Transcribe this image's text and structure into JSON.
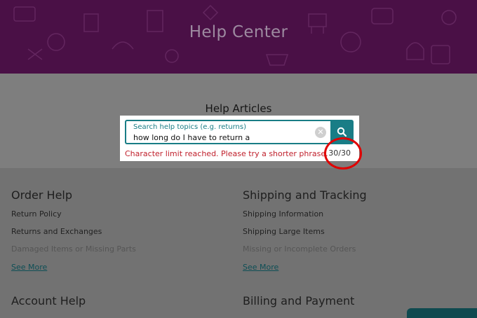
{
  "header": {
    "title": "Help Center",
    "background": "#4a1046"
  },
  "articles": {
    "heading": "Help Articles"
  },
  "search": {
    "placeholder": "Search help topics (e.g. returns)",
    "value": "how long do I have to return a",
    "clear_icon": "clear-icon",
    "search_icon": "magnifier-icon",
    "error": "Character limit reached. Please try a shorter phrase.",
    "count": "30/30",
    "accent": "#197d86",
    "error_color": "#c0202c"
  },
  "sections": {
    "order_help": {
      "title": "Order Help",
      "links": [
        "Return Policy",
        "Returns and Exchanges",
        "Damaged Items or Missing Parts"
      ],
      "see_more": "See More"
    },
    "shipping": {
      "title": "Shipping and Tracking",
      "links": [
        "Shipping Information",
        "Shipping Large Items",
        "Missing or Incomplete Orders"
      ],
      "see_more": "See More"
    },
    "account": {
      "title": "Account Help"
    },
    "billing": {
      "title": "Billing and Payment"
    }
  },
  "annotation": {
    "color": "#e00000"
  }
}
